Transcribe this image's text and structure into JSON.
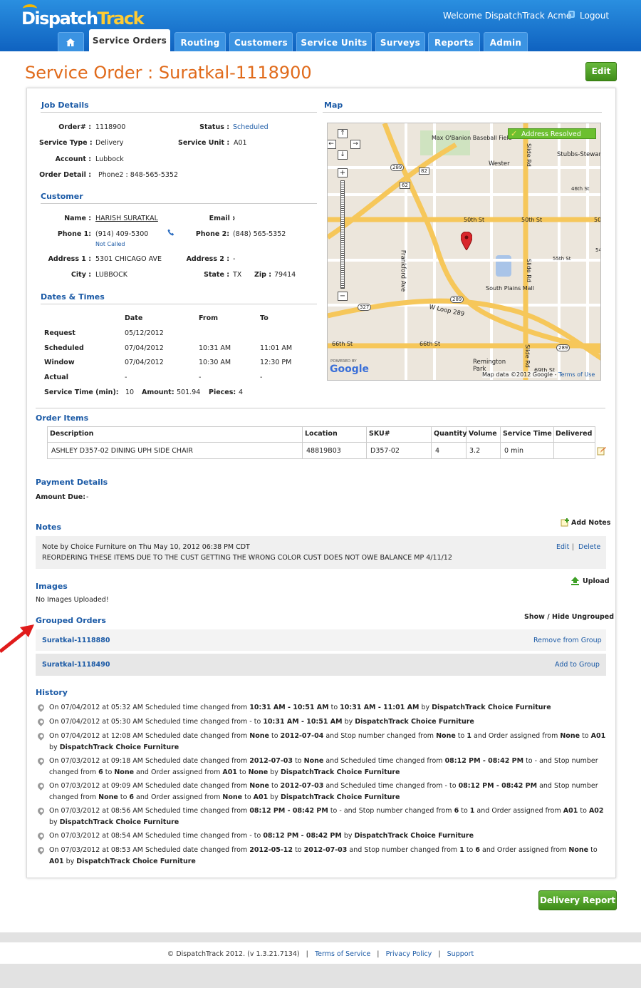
{
  "header": {
    "logo_a": "Dispatch",
    "logo_b": "Track",
    "welcome": "Welcome DispatchTrack Acme",
    "logout": "Logout"
  },
  "tabs": [
    "Service Orders",
    "Routing",
    "Customers",
    "Service Units",
    "Surveys",
    "Reports",
    "Admin"
  ],
  "page": {
    "title": "Service Order : Suratkal-1118900",
    "edit": "Edit",
    "delivery_report": "Delivery Report"
  },
  "job": {
    "heading": "Job Details",
    "order_label": "Order# :",
    "order": "1118900",
    "status_label": "Status :",
    "status": "Scheduled",
    "type_label": "Service Type :",
    "type": "Delivery",
    "unit_label": "Service Unit :",
    "unit": "A01",
    "account_label": "Account :",
    "account": "Lubbock",
    "detail_label": "Order Detail :",
    "detail": "Phone2 : 848-565-5352"
  },
  "customer": {
    "heading": "Customer",
    "name_label": "Name :",
    "name": "HARISH SURATKAL",
    "email_label": "Email :",
    "email": "-",
    "phone1_label": "Phone 1:",
    "phone1": "(914) 409-5300",
    "not_called": "Not Called",
    "phone2_label": "Phone 2:",
    "phone2": "(848) 565-5352",
    "addr1_label": "Address 1 :",
    "addr1": "5301 CHICAGO AVE",
    "addr2_label": "Address 2 :",
    "addr2": "-",
    "city_label": "City :",
    "city": "LUBBOCK",
    "state_label": "State :",
    "state": "TX",
    "zip_label": "Zip :",
    "zip": "79414"
  },
  "dates": {
    "heading": "Dates & Times",
    "cols": [
      "Date",
      "From",
      "To"
    ],
    "rows": [
      [
        "Request",
        "05/12/2012",
        "",
        ""
      ],
      [
        "Scheduled",
        "07/04/2012",
        "10:31 AM",
        "11:01 AM"
      ],
      [
        "Window",
        "07/04/2012",
        "10:30 AM",
        "12:30 PM"
      ],
      [
        "Actual",
        "-",
        "-",
        "-"
      ]
    ],
    "service_time_label": "Service Time (min):",
    "service_time": "10",
    "amount_label": "Amount:",
    "amount": "501.94",
    "pieces_label": "Pieces:",
    "pieces": "4"
  },
  "map": {
    "heading": "Map",
    "badge": "Address Resolved",
    "copyright": "Map data ©2012 Google -",
    "terms": "Terms of Use",
    "powered": "POWERED BY",
    "google": "Google",
    "labels": {
      "baseball": "Max O'Banion Baseball Field",
      "wester": "Wester",
      "stubbs": "Stubbs-Stewar",
      "s46": "46th St",
      "s50a": "50th St",
      "s50b": "50th St",
      "s50c": "50",
      "s55": "55th St",
      "n54": "54",
      "slide1": "Slide Rd",
      "slide2": "Slide Rd",
      "slide3": "Slide Rd",
      "frankford": "Frankford Ave",
      "mall": "South Plains Mall",
      "loop": "W Loop 289",
      "s66a": "66th St",
      "s66b": "66th St",
      "remington": "Remington Park",
      "s69": "69th St",
      "h289a": "289",
      "h82": "82",
      "h62": "62",
      "h289b": "289",
      "h327": "327",
      "h289c": "289"
    }
  },
  "items": {
    "heading": "Order Items",
    "cols": [
      "Description",
      "Location",
      "SKU#",
      "Quantity",
      "Volume",
      "Service Time",
      "Delivered"
    ],
    "row": [
      "ASHLEY D357-02 DINING UPH SIDE CHAIR",
      "48819B03",
      "D357-02",
      "4",
      "3.2",
      "0 min",
      ""
    ]
  },
  "payment": {
    "heading": "Payment Details",
    "due_label": "Amount Due:",
    "due": "-"
  },
  "notes": {
    "heading": "Notes",
    "add": "Add Notes",
    "title": "Note by Choice Furniture on Thu May 10, 2012 06:38 PM CDT",
    "body": "REORDERING THESE ITEMS DUE TO THE CUST GETTING THE WRONG COLOR CUST DOES NOT OWE BALANCE MP 4/11/12",
    "edit": "Edit",
    "delete": "Delete"
  },
  "images": {
    "heading": "Images",
    "upload": "Upload",
    "empty": "No Images Uploaded!"
  },
  "grouped": {
    "heading": "Grouped Orders",
    "toggle": "Show / Hide Ungrouped",
    "rows": [
      {
        "order": "Suratkal-1118880",
        "action": "Remove from Group"
      },
      {
        "order": "Suratkal-1118490",
        "action": "Add to Group"
      }
    ]
  },
  "history": {
    "heading": "History",
    "entries": [
      [
        "On 07/04/2012 at 05:32 AM Scheduled time changed from ",
        "10:31 AM - 10:51 AM",
        " to ",
        "10:31 AM - 11:01 AM",
        " by ",
        "DispatchTrack Choice Furniture"
      ],
      [
        "On 07/04/2012 at 05:30 AM Scheduled time changed from - to ",
        "10:31 AM - 10:51 AM",
        " by ",
        "DispatchTrack Choice Furniture"
      ],
      [
        "On 07/04/2012 at 12:08 AM Scheduled date changed from ",
        "None",
        " to ",
        "2012-07-04",
        " and Stop number changed from ",
        "None",
        " to ",
        "1",
        " and Order assigned from ",
        "None",
        " to ",
        "A01",
        " by ",
        "DispatchTrack Choice Furniture"
      ],
      [
        "On 07/03/2012 at 09:18 AM Scheduled date changed from ",
        "2012-07-03",
        " to ",
        "None",
        " and Scheduled time changed from ",
        "08:12 PM - 08:42 PM",
        " to - and Stop number changed from ",
        "6",
        " to ",
        "None",
        " and Order assigned from ",
        "A01",
        " to ",
        "None",
        " by ",
        "DispatchTrack Choice Furniture"
      ],
      [
        "On 07/03/2012 at 09:09 AM Scheduled date changed from ",
        "None",
        " to ",
        "2012-07-03",
        " and Scheduled time changed from - to ",
        "08:12 PM - 08:42 PM",
        " and Stop number changed from ",
        "None",
        " to ",
        "6",
        " and Order assigned from ",
        "None",
        " to ",
        "A01",
        " by ",
        "DispatchTrack Choice Furniture"
      ],
      [
        "On 07/03/2012 at 08:56 AM Scheduled time changed from ",
        "08:12 PM - 08:42 PM",
        " to - and Stop number changed from ",
        "6",
        " to ",
        "1",
        " and Order assigned from ",
        "A01",
        " to ",
        "A02",
        " by ",
        "DispatchTrack Choice Furniture"
      ],
      [
        "On 07/03/2012 at 08:54 AM Scheduled time changed from - to ",
        "08:12 PM - 08:42 PM",
        " by ",
        "DispatchTrack Choice Furniture"
      ],
      [
        "On 07/03/2012 at 08:53 AM Scheduled date changed from ",
        "2012-05-12",
        " to ",
        "2012-07-03",
        " and Stop number changed from ",
        "1",
        " to ",
        "6",
        " and Order assigned from ",
        "None",
        " to ",
        "A01",
        " by ",
        "DispatchTrack Choice Furniture"
      ]
    ]
  },
  "footer": {
    "copy": "© DispatchTrack 2012. (v 1.3.21.7134)",
    "terms": "Terms of Service",
    "privacy": "Privacy Policy",
    "support": "Support",
    "sep": "|"
  }
}
